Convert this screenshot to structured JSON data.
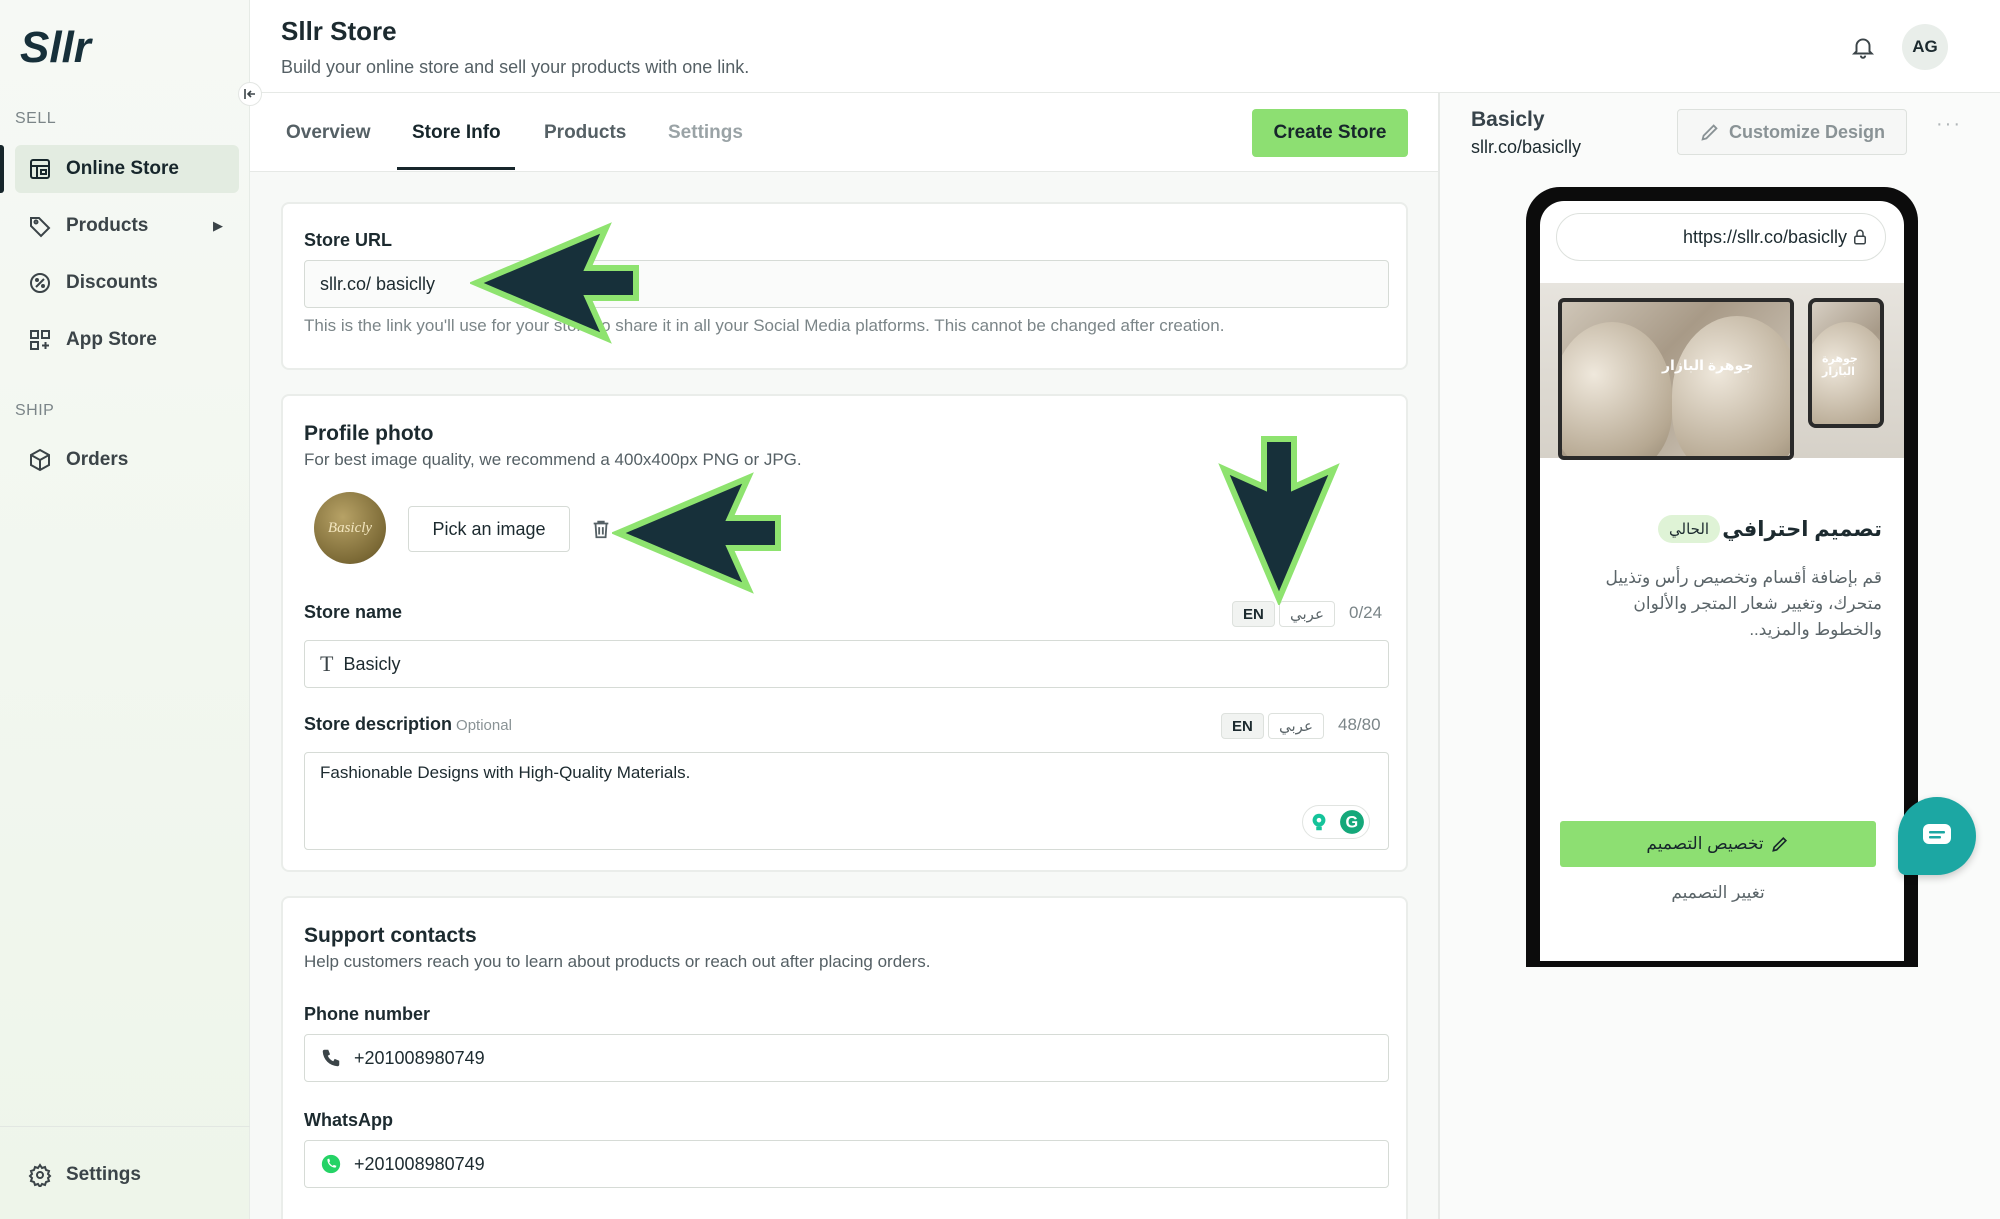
{
  "app": {
    "logo_text": "Sllr"
  },
  "sidebar": {
    "sell_label": "SELL",
    "ship_label": "SHIP",
    "items": [
      {
        "label": "Online Store",
        "icon": "storefront-icon"
      },
      {
        "label": "Products",
        "icon": "tag-icon"
      },
      {
        "label": "Discounts",
        "icon": "discount-badge-icon"
      },
      {
        "label": "App Store",
        "icon": "apps-grid-icon"
      },
      {
        "label": "Orders",
        "icon": "package-icon"
      }
    ],
    "settings_label": "Settings"
  },
  "header": {
    "title": "Sllr Store",
    "subtitle": "Build your online store and sell your products with one link.",
    "avatar_initials": "AG"
  },
  "tabs": {
    "items": [
      "Overview",
      "Store Info",
      "Products",
      "Settings"
    ],
    "active": "Store Info",
    "create_button": "Create Store"
  },
  "store_url": {
    "label": "Store URL",
    "value": "sllr.co/ basiclly",
    "help": "This is the link you'll use for your store to share it in all your Social Media platforms. This cannot be changed after creation."
  },
  "profile_photo": {
    "title": "Profile photo",
    "help": "For best image quality, we recommend a 400x400px PNG or JPG.",
    "logo_text": "Basicly",
    "pick_button": "Pick an image"
  },
  "store_name": {
    "label": "Store name",
    "lang_en": "EN",
    "lang_ar": "عربي",
    "counter": "0/24",
    "value": "Basicly"
  },
  "store_description": {
    "label": "Store description",
    "optional": "Optional",
    "lang_en": "EN",
    "lang_ar": "عربي",
    "counter": "48/80",
    "value": "Fashionable Designs with High-Quality Materials."
  },
  "support": {
    "title": "Support contacts",
    "help": "Help customers reach you to learn about products or reach out after placing orders.",
    "phone_label": "Phone number",
    "phone_value": "+201008980749",
    "whatsapp_label": "WhatsApp",
    "whatsapp_value": "+201008980749"
  },
  "preview": {
    "store_name": "Basicly",
    "store_url": "sllr.co/basiclly",
    "customize_button": "Customize Design",
    "phone_url": "https://sllr.co/basiclly",
    "mock_caption": "جوهرة البازار",
    "theme_name": "تصميم احترافي",
    "current_badge": "الحالي",
    "theme_description": "قم بإضافة أقسام وتخصيص رأس وتذييل متحرك، وتغيير شعار المتجر والألوان والخطوط والمزيد..",
    "customize_ar": "تخصيص التصميم",
    "change_ar": "تغيير التصميم"
  },
  "colors": {
    "accent_green": "#8ddf72",
    "dark": "#17262b",
    "arrow_fill": "#17303a",
    "arrow_outline": "#8ee36f",
    "chat": "#1ca7a3"
  }
}
